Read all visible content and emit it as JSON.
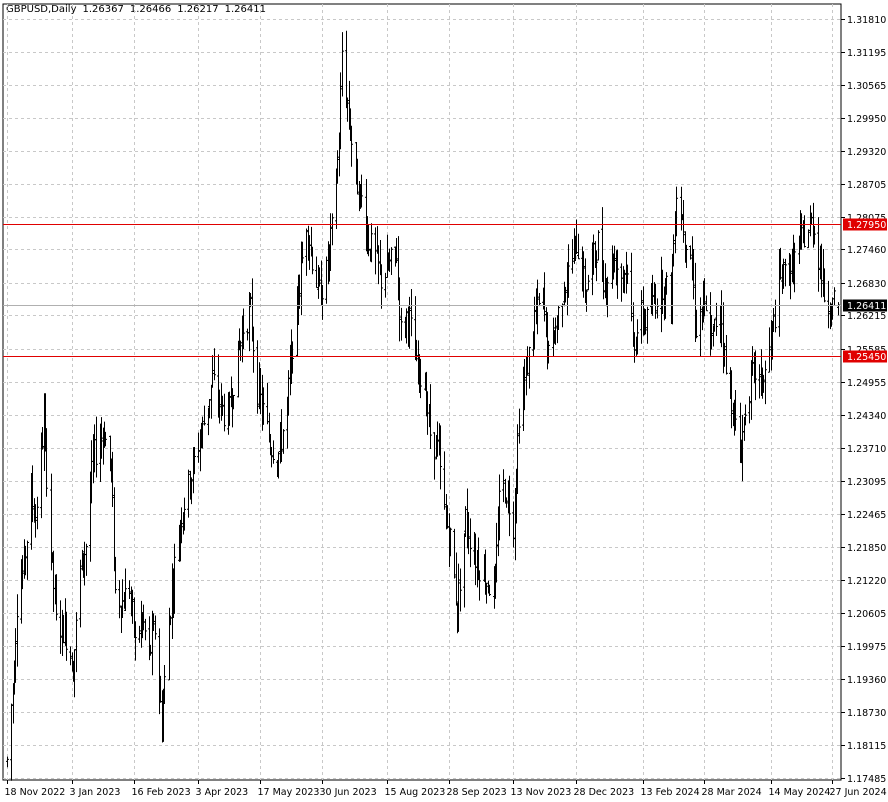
{
  "header": {
    "symbol": "GBPUSD,Daily",
    "open": "1.26367",
    "high": "1.26466",
    "low": "1.26217",
    "close": "1.26411"
  },
  "chart_data": {
    "type": "bar",
    "title": "GBPUSD,Daily",
    "y_ticks": [
      "1.31810",
      "1.31195",
      "1.30565",
      "1.29950",
      "1.29320",
      "1.28705",
      "1.28075",
      "1.27460",
      "1.26830",
      "1.26215",
      "1.25585",
      "1.24955",
      "1.24340",
      "1.23710",
      "1.23095",
      "1.22465",
      "1.21850",
      "1.21220",
      "1.20605",
      "1.19975",
      "1.19360",
      "1.18730",
      "1.18115",
      "1.17485"
    ],
    "x_ticks": [
      "18 Nov 2022",
      "3 Jan 2023",
      "16 Feb 2023",
      "3 Apr 2023",
      "17 May 2023",
      "30 Jun 2023",
      "15 Aug 2023",
      "28 Sep 2023",
      "13 Nov 2023",
      "28 Dec 2023",
      "13 Feb 2024",
      "28 Mar 2024",
      "14 May 2024",
      "27 Jun 2024"
    ],
    "ylim": [
      1.17485,
      1.3181
    ],
    "levels": [
      {
        "value": 1.2795,
        "label": "1.27950",
        "color": "#e00000"
      },
      {
        "value": 1.2545,
        "label": "1.25450",
        "color": "#e00000"
      }
    ],
    "current_price": {
      "value": 1.26411,
      "label": "1.26411"
    },
    "bar_color": "#000000",
    "grid": true,
    "anchors": [
      [
        "2022-11-18",
        1.178
      ],
      [
        "2022-11-22",
        1.192
      ],
      [
        "2022-11-25",
        1.208
      ],
      [
        "2022-11-30",
        1.215
      ],
      [
        "2022-12-05",
        1.228
      ],
      [
        "2022-12-08",
        1.224
      ],
      [
        "2022-12-14",
        1.242
      ],
      [
        "2022-12-19",
        1.218
      ],
      [
        "2022-12-23",
        1.204
      ],
      [
        "2022-12-29",
        1.203
      ],
      [
        "2023-01-04",
        1.196
      ],
      [
        "2023-01-09",
        1.214
      ],
      [
        "2023-01-13",
        1.219
      ],
      [
        "2023-01-18",
        1.235
      ],
      [
        "2023-01-23",
        1.239
      ],
      [
        "2023-01-26",
        1.24
      ],
      [
        "2023-01-31",
        1.233
      ],
      [
        "2023-02-03",
        1.21
      ],
      [
        "2023-02-08",
        1.208
      ],
      [
        "2023-02-13",
        1.211
      ],
      [
        "2023-02-17",
        1.2
      ],
      [
        "2023-02-22",
        1.205
      ],
      [
        "2023-02-27",
        1.198
      ],
      [
        "2023-03-03",
        1.203
      ],
      [
        "2023-03-08",
        1.185
      ],
      [
        "2023-03-13",
        1.205
      ],
      [
        "2023-03-17",
        1.215
      ],
      [
        "2023-03-22",
        1.225
      ],
      [
        "2023-03-28",
        1.231
      ],
      [
        "2023-04-03",
        1.238
      ],
      [
        "2023-04-07",
        1.242
      ],
      [
        "2023-04-13",
        1.25
      ],
      [
        "2023-04-19",
        1.245
      ],
      [
        "2023-04-24",
        1.242
      ],
      [
        "2023-04-28",
        1.25
      ],
      [
        "2023-05-05",
        1.26
      ],
      [
        "2023-05-10",
        1.263
      ],
      [
        "2023-05-15",
        1.248
      ],
      [
        "2023-05-19",
        1.244
      ],
      [
        "2023-05-24",
        1.238
      ],
      [
        "2023-05-30",
        1.236
      ],
      [
        "2023-06-05",
        1.245
      ],
      [
        "2023-06-09",
        1.257
      ],
      [
        "2023-06-14",
        1.268
      ],
      [
        "2023-06-19",
        1.28
      ],
      [
        "2023-06-23",
        1.273
      ],
      [
        "2023-06-28",
        1.266
      ],
      [
        "2023-07-03",
        1.27
      ],
      [
        "2023-07-07",
        1.278
      ],
      [
        "2023-07-12",
        1.295
      ],
      [
        "2023-07-14",
        1.312
      ],
      [
        "2023-07-18",
        1.302
      ],
      [
        "2023-07-24",
        1.288
      ],
      [
        "2023-07-28",
        1.284
      ],
      [
        "2023-08-02",
        1.276
      ],
      [
        "2023-08-07",
        1.273
      ],
      [
        "2023-08-11",
        1.269
      ],
      [
        "2023-08-16",
        1.271
      ],
      [
        "2023-08-22",
        1.274
      ],
      [
        "2023-08-25",
        1.259
      ],
      [
        "2023-08-30",
        1.263
      ],
      [
        "2023-09-05",
        1.252
      ],
      [
        "2023-09-11",
        1.249
      ],
      [
        "2023-09-15",
        1.24
      ],
      [
        "2023-09-20",
        1.237
      ],
      [
        "2023-09-25",
        1.225
      ],
      [
        "2023-09-29",
        1.22
      ],
      [
        "2023-10-04",
        1.207
      ],
      [
        "2023-10-10",
        1.224
      ],
      [
        "2023-10-16",
        1.217
      ],
      [
        "2023-10-20",
        1.215
      ],
      [
        "2023-10-25",
        1.212
      ],
      [
        "2023-10-31",
        1.21
      ],
      [
        "2023-11-03",
        1.23
      ],
      [
        "2023-11-08",
        1.229
      ],
      [
        "2023-11-13",
        1.223
      ],
      [
        "2023-11-17",
        1.244
      ],
      [
        "2023-11-22",
        1.251
      ],
      [
        "2023-11-28",
        1.262
      ],
      [
        "2023-12-04",
        1.265
      ],
      [
        "2023-12-08",
        1.254
      ],
      [
        "2023-12-13",
        1.26
      ],
      [
        "2023-12-19",
        1.268
      ],
      [
        "2023-12-22",
        1.27
      ],
      [
        "2023-12-28",
        1.276
      ],
      [
        "2024-01-03",
        1.267
      ],
      [
        "2024-01-08",
        1.272
      ],
      [
        "2024-01-12",
        1.276
      ],
      [
        "2024-01-17",
        1.268
      ],
      [
        "2024-01-23",
        1.273
      ],
      [
        "2024-01-29",
        1.27
      ],
      [
        "2024-02-02",
        1.272
      ],
      [
        "2024-02-06",
        1.257
      ],
      [
        "2024-02-12",
        1.262
      ],
      [
        "2024-02-16",
        1.261
      ],
      [
        "2024-02-21",
        1.265
      ],
      [
        "2024-02-27",
        1.268
      ],
      [
        "2024-03-04",
        1.266
      ],
      [
        "2024-03-08",
        1.286
      ],
      [
        "2024-03-13",
        1.279
      ],
      [
        "2024-03-18",
        1.274
      ],
      [
        "2024-03-22",
        1.26
      ],
      [
        "2024-03-27",
        1.264
      ],
      [
        "2024-04-02",
        1.257
      ],
      [
        "2024-04-08",
        1.265
      ],
      [
        "2024-04-12",
        1.251
      ],
      [
        "2024-04-17",
        1.245
      ],
      [
        "2024-04-22",
        1.235
      ],
      [
        "2024-04-26",
        1.245
      ],
      [
        "2024-05-02",
        1.252
      ],
      [
        "2024-05-07",
        1.249
      ],
      [
        "2024-05-10",
        1.251
      ],
      [
        "2024-05-14",
        1.257
      ],
      [
        "2024-05-20",
        1.268
      ],
      [
        "2024-05-24",
        1.27
      ],
      [
        "2024-05-30",
        1.272
      ],
      [
        "2024-06-04",
        1.276
      ],
      [
        "2024-06-10",
        1.278
      ],
      [
        "2024-06-13",
        1.28
      ],
      [
        "2024-06-18",
        1.272
      ],
      [
        "2024-06-21",
        1.266
      ],
      [
        "2024-06-26",
        1.264
      ],
      [
        "2024-07-01",
        1.2641
      ]
    ]
  }
}
